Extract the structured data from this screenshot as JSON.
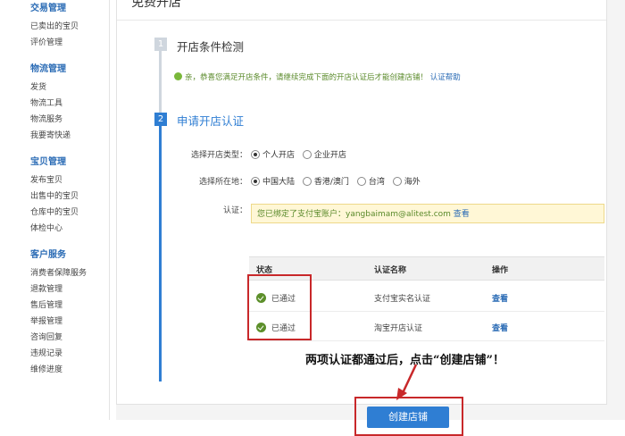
{
  "sidebar": {
    "groups": [
      {
        "title": "交易管理",
        "items": [
          "已卖出的宝贝",
          "评价管理"
        ]
      },
      {
        "title": "物流管理",
        "items": [
          "发货",
          "物流工具",
          "物流服务",
          "我要寄快递"
        ]
      },
      {
        "title": "宝贝管理",
        "items": [
          "发布宝贝",
          "出售中的宝贝",
          "仓库中的宝贝",
          "体检中心"
        ]
      },
      {
        "title": "客户服务",
        "items": [
          "消费者保障服务",
          "退款管理",
          "售后管理",
          "举报管理",
          "咨询回复",
          "违规记录",
          "维修进度"
        ]
      }
    ]
  },
  "page": {
    "title": "免费开店"
  },
  "step1": {
    "num": "1",
    "title": "开店条件检测",
    "success_text": "恭喜您满足开店条件，请继续完成下面的开店认证后才能创建店铺！",
    "success_prefix": "亲，",
    "help_link": "认证帮助"
  },
  "step2": {
    "num": "2",
    "title": "申请开店认证"
  },
  "form": {
    "shop_type_label": "选择开店类型：",
    "shop_type_options": [
      "个人开店",
      "企业开店"
    ],
    "location_label": "选择所在地：",
    "location_options": [
      "中国大陆",
      "香港/澳门",
      "台湾",
      "海外"
    ],
    "cert_label": "认证：",
    "alipay_text": "您已绑定了支付宝账户：yangbaimam@alitest.com",
    "alipay_view": "查看"
  },
  "table": {
    "headers": [
      "状态",
      "认证名称",
      "操作"
    ],
    "rows": [
      {
        "status": "已通过",
        "name": "支付宝实名认证",
        "action": "查看"
      },
      {
        "status": "已通过",
        "name": "淘宝开店认证",
        "action": "查看"
      }
    ]
  },
  "annotation": "两项认证都通过后，点击“创建店铺”！",
  "create_button": "创建店铺",
  "colors": {
    "accent": "#2f7ed3",
    "success": "#5c8f2a",
    "highlight": "#c8282a"
  }
}
